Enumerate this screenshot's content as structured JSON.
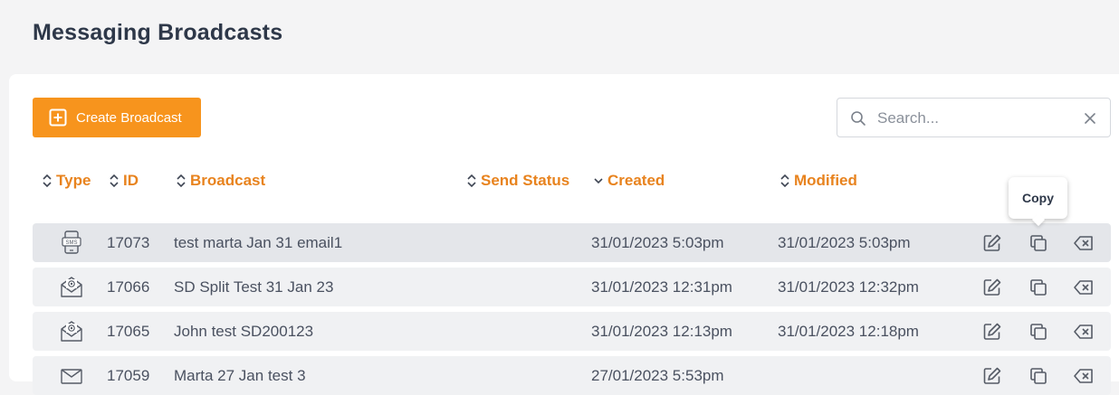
{
  "page": {
    "title": "Messaging Broadcasts"
  },
  "toolbar": {
    "create_label": "Create Broadcast",
    "create_icon": "plus-square-icon"
  },
  "search": {
    "placeholder": "Search...",
    "value": ""
  },
  "table": {
    "columns": [
      "Type",
      "ID",
      "Broadcast",
      "Send Status",
      "Created",
      "Modified"
    ],
    "sorted_column": "Created",
    "rows": [
      {
        "type": "sms-icon",
        "id": "17073",
        "broadcast": "test marta Jan 31 email1",
        "send_status": "",
        "created": "31/01/2023 5:03pm",
        "modified": "31/01/2023 5:03pm"
      },
      {
        "type": "email-icon",
        "id": "17066",
        "broadcast": "SD Split Test 31 Jan 23",
        "send_status": "",
        "created": "31/01/2023 12:31pm",
        "modified": "31/01/2023 12:32pm"
      },
      {
        "type": "email-icon",
        "id": "17065",
        "broadcast": "John test SD200123",
        "send_status": "",
        "created": "31/01/2023 12:13pm",
        "modified": "31/01/2023 12:18pm"
      },
      {
        "type": "envelope-icon",
        "id": "17059",
        "broadcast": "Marta 27 Jan test 3",
        "send_status": "",
        "created": "27/01/2023 5:53pm",
        "modified": ""
      }
    ],
    "row_actions": [
      "edit-icon",
      "copy-icon",
      "delete-icon"
    ]
  },
  "tooltip": {
    "label": "Copy"
  },
  "colors": {
    "accent": "#f7941d",
    "header_text": "#e8831e",
    "title": "#2e3849"
  }
}
